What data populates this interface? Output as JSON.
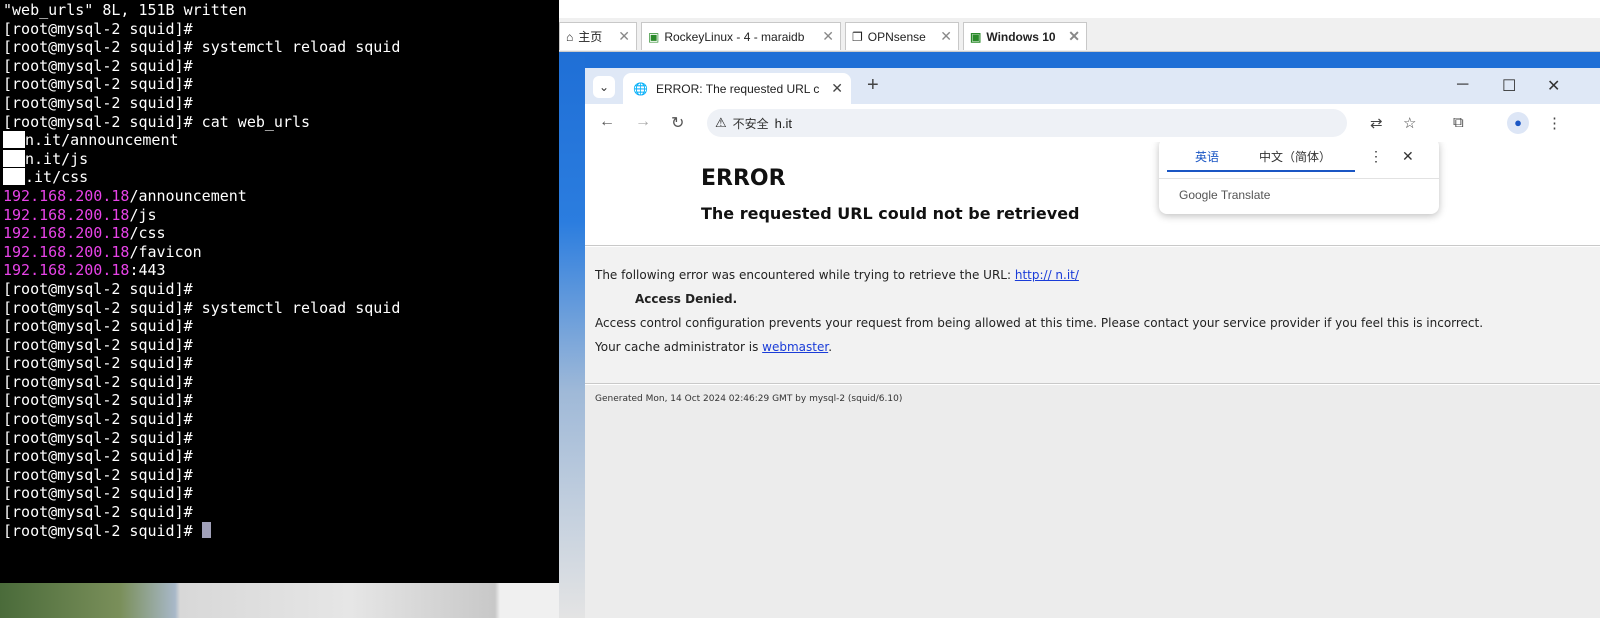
{
  "terminal": {
    "lines": [
      {
        "text": "\"web_urls\" 8L, 151B written"
      },
      {
        "text": "[root@mysql-2 squid]#"
      },
      {
        "text": "[root@mysql-2 squid]# systemctl reload squid"
      },
      {
        "text": "[root@mysql-2 squid]#"
      },
      {
        "text": "[root@mysql-2 squid]#"
      },
      {
        "text": "[root@mysql-2 squid]#"
      },
      {
        "text": "[root@mysql-2 squid]# cat web_urls"
      },
      {
        "text": "n.it/announcement",
        "mask": true
      },
      {
        "text": "n.it/js",
        "mask": true
      },
      {
        "text": ".it/css",
        "mask": true
      },
      {
        "pink": "192.168.200.18",
        "text": "/announcement"
      },
      {
        "pink": "192.168.200.18",
        "text": "/js"
      },
      {
        "pink": "192.168.200.18",
        "text": "/css"
      },
      {
        "pink": "192.168.200.18",
        "text": "/favicon"
      },
      {
        "pink": "192.168.200.18",
        "text": ":443"
      },
      {
        "text": "[root@mysql-2 squid]#"
      },
      {
        "text": "[root@mysql-2 squid]# systemctl reload squid"
      },
      {
        "text": "[root@mysql-2 squid]#"
      },
      {
        "text": "[root@mysql-2 squid]#"
      },
      {
        "text": "[root@mysql-2 squid]#"
      },
      {
        "text": "[root@mysql-2 squid]#"
      },
      {
        "text": "[root@mysql-2 squid]#"
      },
      {
        "text": "[root@mysql-2 squid]#"
      },
      {
        "text": "[root@mysql-2 squid]#"
      },
      {
        "text": "[root@mysql-2 squid]#"
      },
      {
        "text": "[root@mysql-2 squid]#"
      },
      {
        "text": "[root@mysql-2 squid]#"
      },
      {
        "text": "[root@mysql-2 squid]#"
      },
      {
        "text": "[root@mysql-2 squid]# ",
        "cursor": true
      }
    ]
  },
  "vm_tabs": [
    {
      "label": "主页",
      "icon": "home-icon"
    },
    {
      "label": "RockeyLinux - 4 - maraidb",
      "icon": "vm-running-icon"
    },
    {
      "label": "OPNsense",
      "icon": "vm-icon"
    },
    {
      "label": "Windows 10",
      "icon": "vm-running-icon"
    }
  ],
  "browser": {
    "tab_title": "ERROR: The requested URL c",
    "new_tab": "+",
    "insecure_label": "不安全",
    "url": "h.it",
    "translate": {
      "lang_source": "英语",
      "lang_target": "中文（简体）",
      "brand": "Google Translate"
    },
    "page": {
      "title": "ERROR",
      "subtitle": "The requested URL could not be retrieved",
      "encounter_text": "The following error was encountered while trying to retrieve the URL: ",
      "encounter_link": "http://   n.it/",
      "denied": "Access Denied.",
      "access_text": "Access control configuration prevents your request from being allowed at this time. Please contact your service provider if you feel this is incorrect.",
      "cache_text": "Your cache administrator is ",
      "cache_link": "webmaster",
      "footer": "Generated Mon, 14 Oct 2024 02:46:29 GMT by mysql-2 (squid/6.10)"
    }
  },
  "colors": {
    "terminal_bg": "#000000",
    "ip_pink": "#e843e8",
    "link_blue": "#1a3cd8",
    "desktop_blue": "#1f6fd6"
  }
}
